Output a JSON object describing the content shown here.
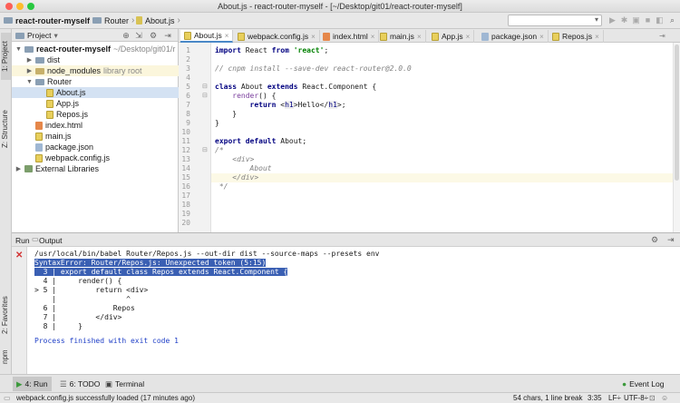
{
  "window": {
    "title": "About.js - react-router-myself - [~/Desktop/git01/react-router-myself]"
  },
  "nav": {
    "breadcrumbs": [
      "react-router-myself",
      "Router",
      "About.js"
    ]
  },
  "left_stripe": {
    "project": "1: Project",
    "structure": "Z: Structure",
    "favorites": "2: Favorites",
    "npm": "npm"
  },
  "project_panel": {
    "selector": "Project",
    "tree": [
      {
        "label": "react-router-myself",
        "suffix": "~/Desktop/git01/r",
        "type": "folder",
        "arrow": "▼",
        "level": 0
      },
      {
        "label": "dist",
        "suffix": "",
        "type": "folder",
        "arrow": "▶",
        "level": 1
      },
      {
        "label": "node_modules",
        "suffix": "library root",
        "type": "folder",
        "arrow": "▶",
        "level": 1
      },
      {
        "label": "Router",
        "suffix": "",
        "type": "folder",
        "arrow": "▼",
        "level": 1
      },
      {
        "label": "About.js",
        "suffix": "",
        "type": "js",
        "arrow": "",
        "level": 2
      },
      {
        "label": "App.js",
        "suffix": "",
        "type": "js",
        "arrow": "",
        "level": 2
      },
      {
        "label": "Repos.js",
        "suffix": "",
        "type": "js",
        "arrow": "",
        "level": 2
      },
      {
        "label": "index.html",
        "suffix": "",
        "type": "html",
        "arrow": "",
        "level": 1
      },
      {
        "label": "main.js",
        "suffix": "",
        "type": "js",
        "arrow": "",
        "level": 1
      },
      {
        "label": "package.json",
        "suffix": "",
        "type": "json",
        "arrow": "",
        "level": 1
      },
      {
        "label": "webpack.config.js",
        "suffix": "",
        "type": "js",
        "arrow": "",
        "level": 1
      },
      {
        "label": "External Libraries",
        "suffix": "",
        "type": "lib",
        "arrow": "▶",
        "level": 0
      }
    ]
  },
  "editor": {
    "tabs": [
      "About.js",
      "webpack.config.js",
      "index.html",
      "main.js",
      "App.js",
      "package.json",
      "Repos.js"
    ],
    "active_tab": "About.js",
    "line_numbers": [
      "1",
      "2",
      "3",
      "4",
      "5",
      "6",
      "7",
      "8",
      "9",
      "10",
      "11",
      "12",
      "13",
      "14",
      "15",
      "16",
      "17",
      "18",
      "19",
      "20"
    ]
  },
  "run_panel": {
    "tab_run": "Run",
    "tab_output": "Output",
    "command": "/usr/local/bin/babel Router/Repos.js --out-dir dist --source-maps --presets env",
    "error": "SyntaxError: Router/Repos.js: Unexpected token (5:15)",
    "error_code": [
      "  3 | export default class Repos extends React.Component {",
      "  4 |     render() {",
      "> 5 |         return <div>",
      "    |                ^",
      "  6 |             Repos",
      "  7 |         </div>",
      "  8 |     }"
    ],
    "finished": "Process finished with exit code 1"
  },
  "bottom_tabs": {
    "run": "4: Run",
    "todo": "6: TODO",
    "terminal": "Terminal",
    "event_log": "Event Log"
  },
  "status": {
    "message": "webpack.config.js successfully loaded (17 minutes ago)",
    "chars": "54 chars, 1 line break",
    "position": "3:35",
    "line_sep": "LF÷",
    "encoding": "UTF-8÷"
  },
  "colors": {
    "accent": "#4a88c7",
    "error_highlight": "#3a5fb3",
    "run_green": "#3c9a3c",
    "error_red": "#d23434"
  }
}
